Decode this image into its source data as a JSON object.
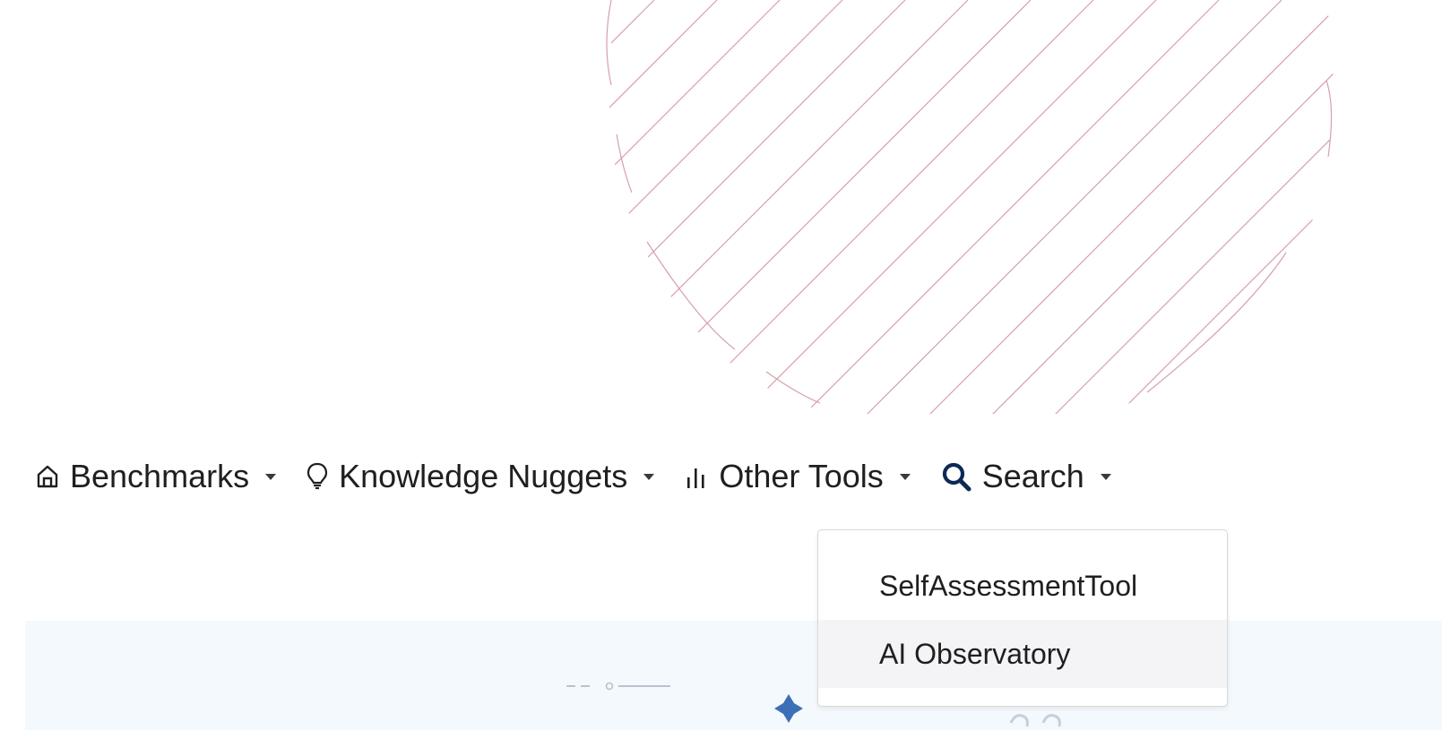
{
  "navbar": {
    "items": [
      {
        "label": "Benchmarks",
        "icon": "home-icon"
      },
      {
        "label": "Knowledge Nuggets",
        "icon": "lightbulb-icon"
      },
      {
        "label": "Other Tools",
        "icon": "bar-chart-icon"
      },
      {
        "label": "Search",
        "icon": "search-icon"
      }
    ]
  },
  "dropdown": {
    "items": [
      {
        "label": "SelfAssessmentTool"
      },
      {
        "label": "AI Observatory"
      }
    ]
  },
  "colors": {
    "hatch_stroke": "#d6a1ab",
    "banner_bg": "#f4f9fe",
    "accent_blue": "#3d6fb6",
    "search_icon": "#0b2a54"
  }
}
